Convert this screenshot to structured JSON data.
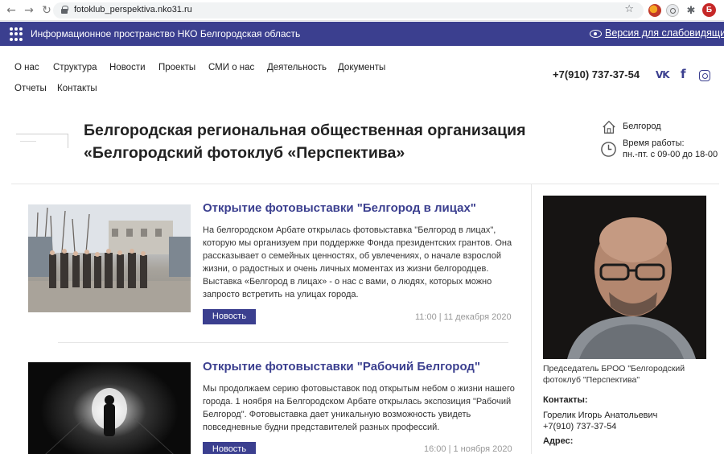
{
  "browser": {
    "url": "fotoklub_perspektiva.nko31.ru",
    "profile_initial": "Б"
  },
  "topbar": {
    "title": "Информационное пространство НКО Белгородская область",
    "low_vision": "Версия для слабовидящих",
    "bg_color": "#3b3f8f"
  },
  "nav": {
    "items": [
      "О нас",
      "Структура",
      "Новости",
      "Проекты",
      "СМИ о нас",
      "Деятельность",
      "Документы",
      "Отчеты",
      "Контакты"
    ]
  },
  "header": {
    "phone": "+7(910) 737-37-54",
    "org_title": "Белгородская региональная общественная организация «Белгородский фотоклуб «Перспектива»",
    "city": "Белгород",
    "hours_label": "Время работы:",
    "hours": "пн.-пт. с 09-00 до 18-00"
  },
  "news": [
    {
      "title": "Открытие фотовыставки \"Белгород в лицах\"",
      "text": "На белгородском Арбате открылась фотовыставка \"Белгород в лицах\", которую мы организуем при поддержке Фонда президентских грантов. Она рассказывает о семейных ценностях, об увлечениях, о начале взрослой жизни, о радостных и очень личных моментах из жизни белгородцев. Выставка «Белгород в лицах» - о нас с вами, о людях, которых можно запросто встретить на улицах города.",
      "badge": "Новость",
      "date": "11:00 | 11 декабря 2020"
    },
    {
      "title": "Открытие фотовыставки \"Рабочий Белгород\"",
      "text": "Мы продолжаем серию фотовыставок под открытым небом о жизни нашего города. 1 ноября на Белгородском Арбате открылась экспозиция \"Рабочий Белгород\". Фотовыставка дает уникальную возможность увидеть повседневные будни представителей разных профессий.",
      "badge": "Новость",
      "date": "16:00 | 1 ноября 2020"
    }
  ],
  "sidebar": {
    "chair_title": "Председатель БРОО \"Белгородский фотоклуб \"Перспектива\"",
    "contacts_label": "Контакты:",
    "person": "Горелик Игорь Анатольевич",
    "phone": "+7(910) 737-37-54",
    "address_label": "Адрес:"
  }
}
